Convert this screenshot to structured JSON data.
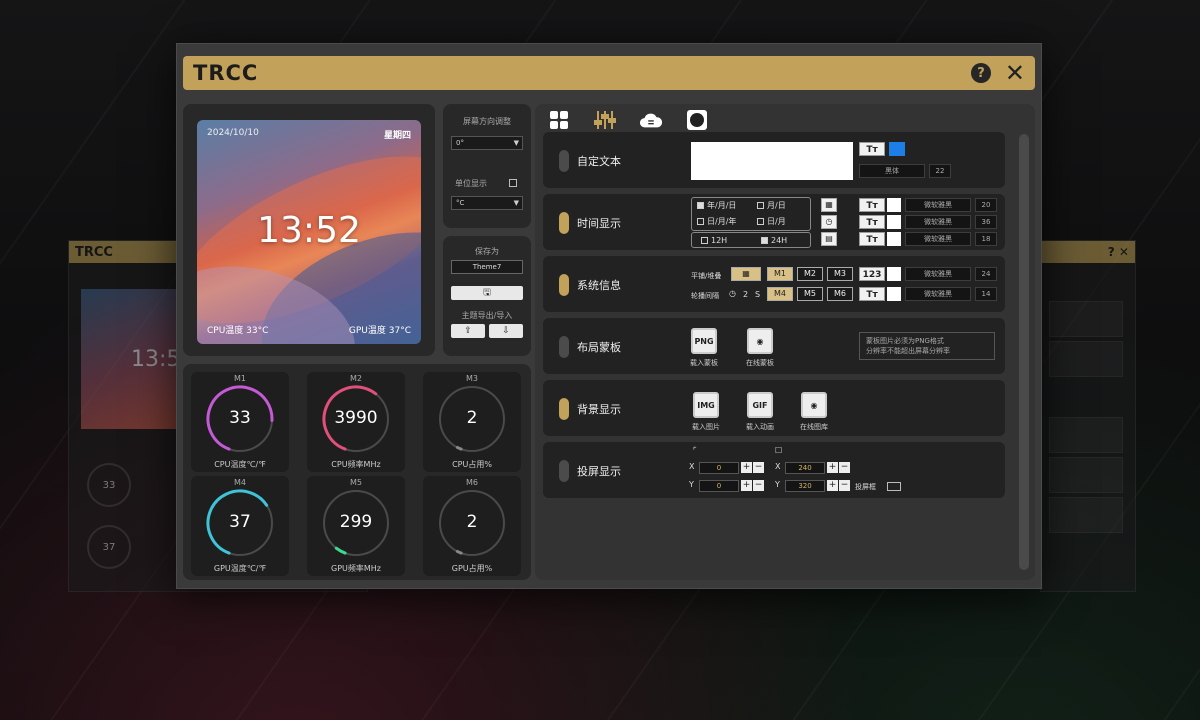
{
  "app": {
    "title": "TRCC"
  },
  "ghost_left": {
    "title": "TRCC",
    "time": "13:52",
    "rings": [
      "33",
      "37"
    ]
  },
  "preview": {
    "date": "2024/10/10",
    "weekday": "星期四",
    "time": "13:52",
    "cpu_temp": "CPU温度 33°C",
    "gpu_temp": "GPU温度 37°C"
  },
  "controls": {
    "rotation_label": "屏幕方向调整",
    "rotation_value": "0°",
    "unit_label": "单位显示",
    "unit_value": "°C",
    "save_label": "保存为",
    "theme_name": "Theme7",
    "import_export_label": "主题导出/导入"
  },
  "meters": [
    {
      "tag": "M1",
      "value": "33",
      "unit": "CPU温度℃/℉",
      "color": "#c45ad6",
      "level": 0.7
    },
    {
      "tag": "M2",
      "value": "3990",
      "unit": "CPU频率MHz",
      "color": "#e0507a",
      "level": 0.55
    },
    {
      "tag": "M3",
      "value": "2",
      "unit": "CPU占用%",
      "color": "#888888",
      "level": 0.02
    },
    {
      "tag": "M4",
      "value": "37",
      "unit": "GPU温度℃/℉",
      "color": "#3fc3d8",
      "level": 0.6
    },
    {
      "tag": "M5",
      "value": "299",
      "unit": "GPU频率MHz",
      "color": "#3fd88f",
      "level": 0.05
    },
    {
      "tag": "M6",
      "value": "2",
      "unit": "GPU占用%",
      "color": "#888888",
      "level": 0.02
    }
  ],
  "settings": {
    "tabs": [
      "grid-icon",
      "sliders-icon",
      "cloud-icon",
      "circle-icon"
    ],
    "custom_text": {
      "label": "自定文本",
      "font": "黑体",
      "size": "22",
      "color": "#1d7ee8"
    },
    "time_display": {
      "label": "时间显示",
      "options": [
        "年/月/日",
        "月/日",
        "日/月/年",
        "日/月"
      ],
      "format_12h": "12H",
      "format_24h": "24H",
      "fonts": [
        "微软雅黑",
        "微软雅黑",
        "微软雅黑"
      ],
      "sizes": [
        "20",
        "36",
        "18"
      ]
    },
    "system_info": {
      "label": "系统信息",
      "layout_label": "平铺/堆叠",
      "interval_label": "轮播间隔",
      "interval_value": "2",
      "interval_unit": "S",
      "buttons_row1": [
        "M1",
        "M2",
        "M3"
      ],
      "buttons_row2": [
        "M4",
        "M5",
        "M6"
      ],
      "num_label": "123",
      "fonts": [
        "微软雅黑",
        "微软雅黑"
      ],
      "sizes": [
        "24",
        "14"
      ]
    },
    "layout_mask": {
      "label": "布局蒙板",
      "load_label": "载入蒙板",
      "online_label": "在线蒙板",
      "note_line1": "蒙板图片必须为PNG格式",
      "note_line2": "分辨率不能超出屏幕分辨率"
    },
    "background": {
      "label": "背景显示",
      "image_label": "载入图片",
      "animation_label": "载入动画",
      "online_label": "在线图库"
    },
    "screencast": {
      "label": "投屏显示",
      "x1": "0",
      "y1": "0",
      "x2": "240",
      "y2": "320",
      "cast_label": "投屏框"
    }
  }
}
